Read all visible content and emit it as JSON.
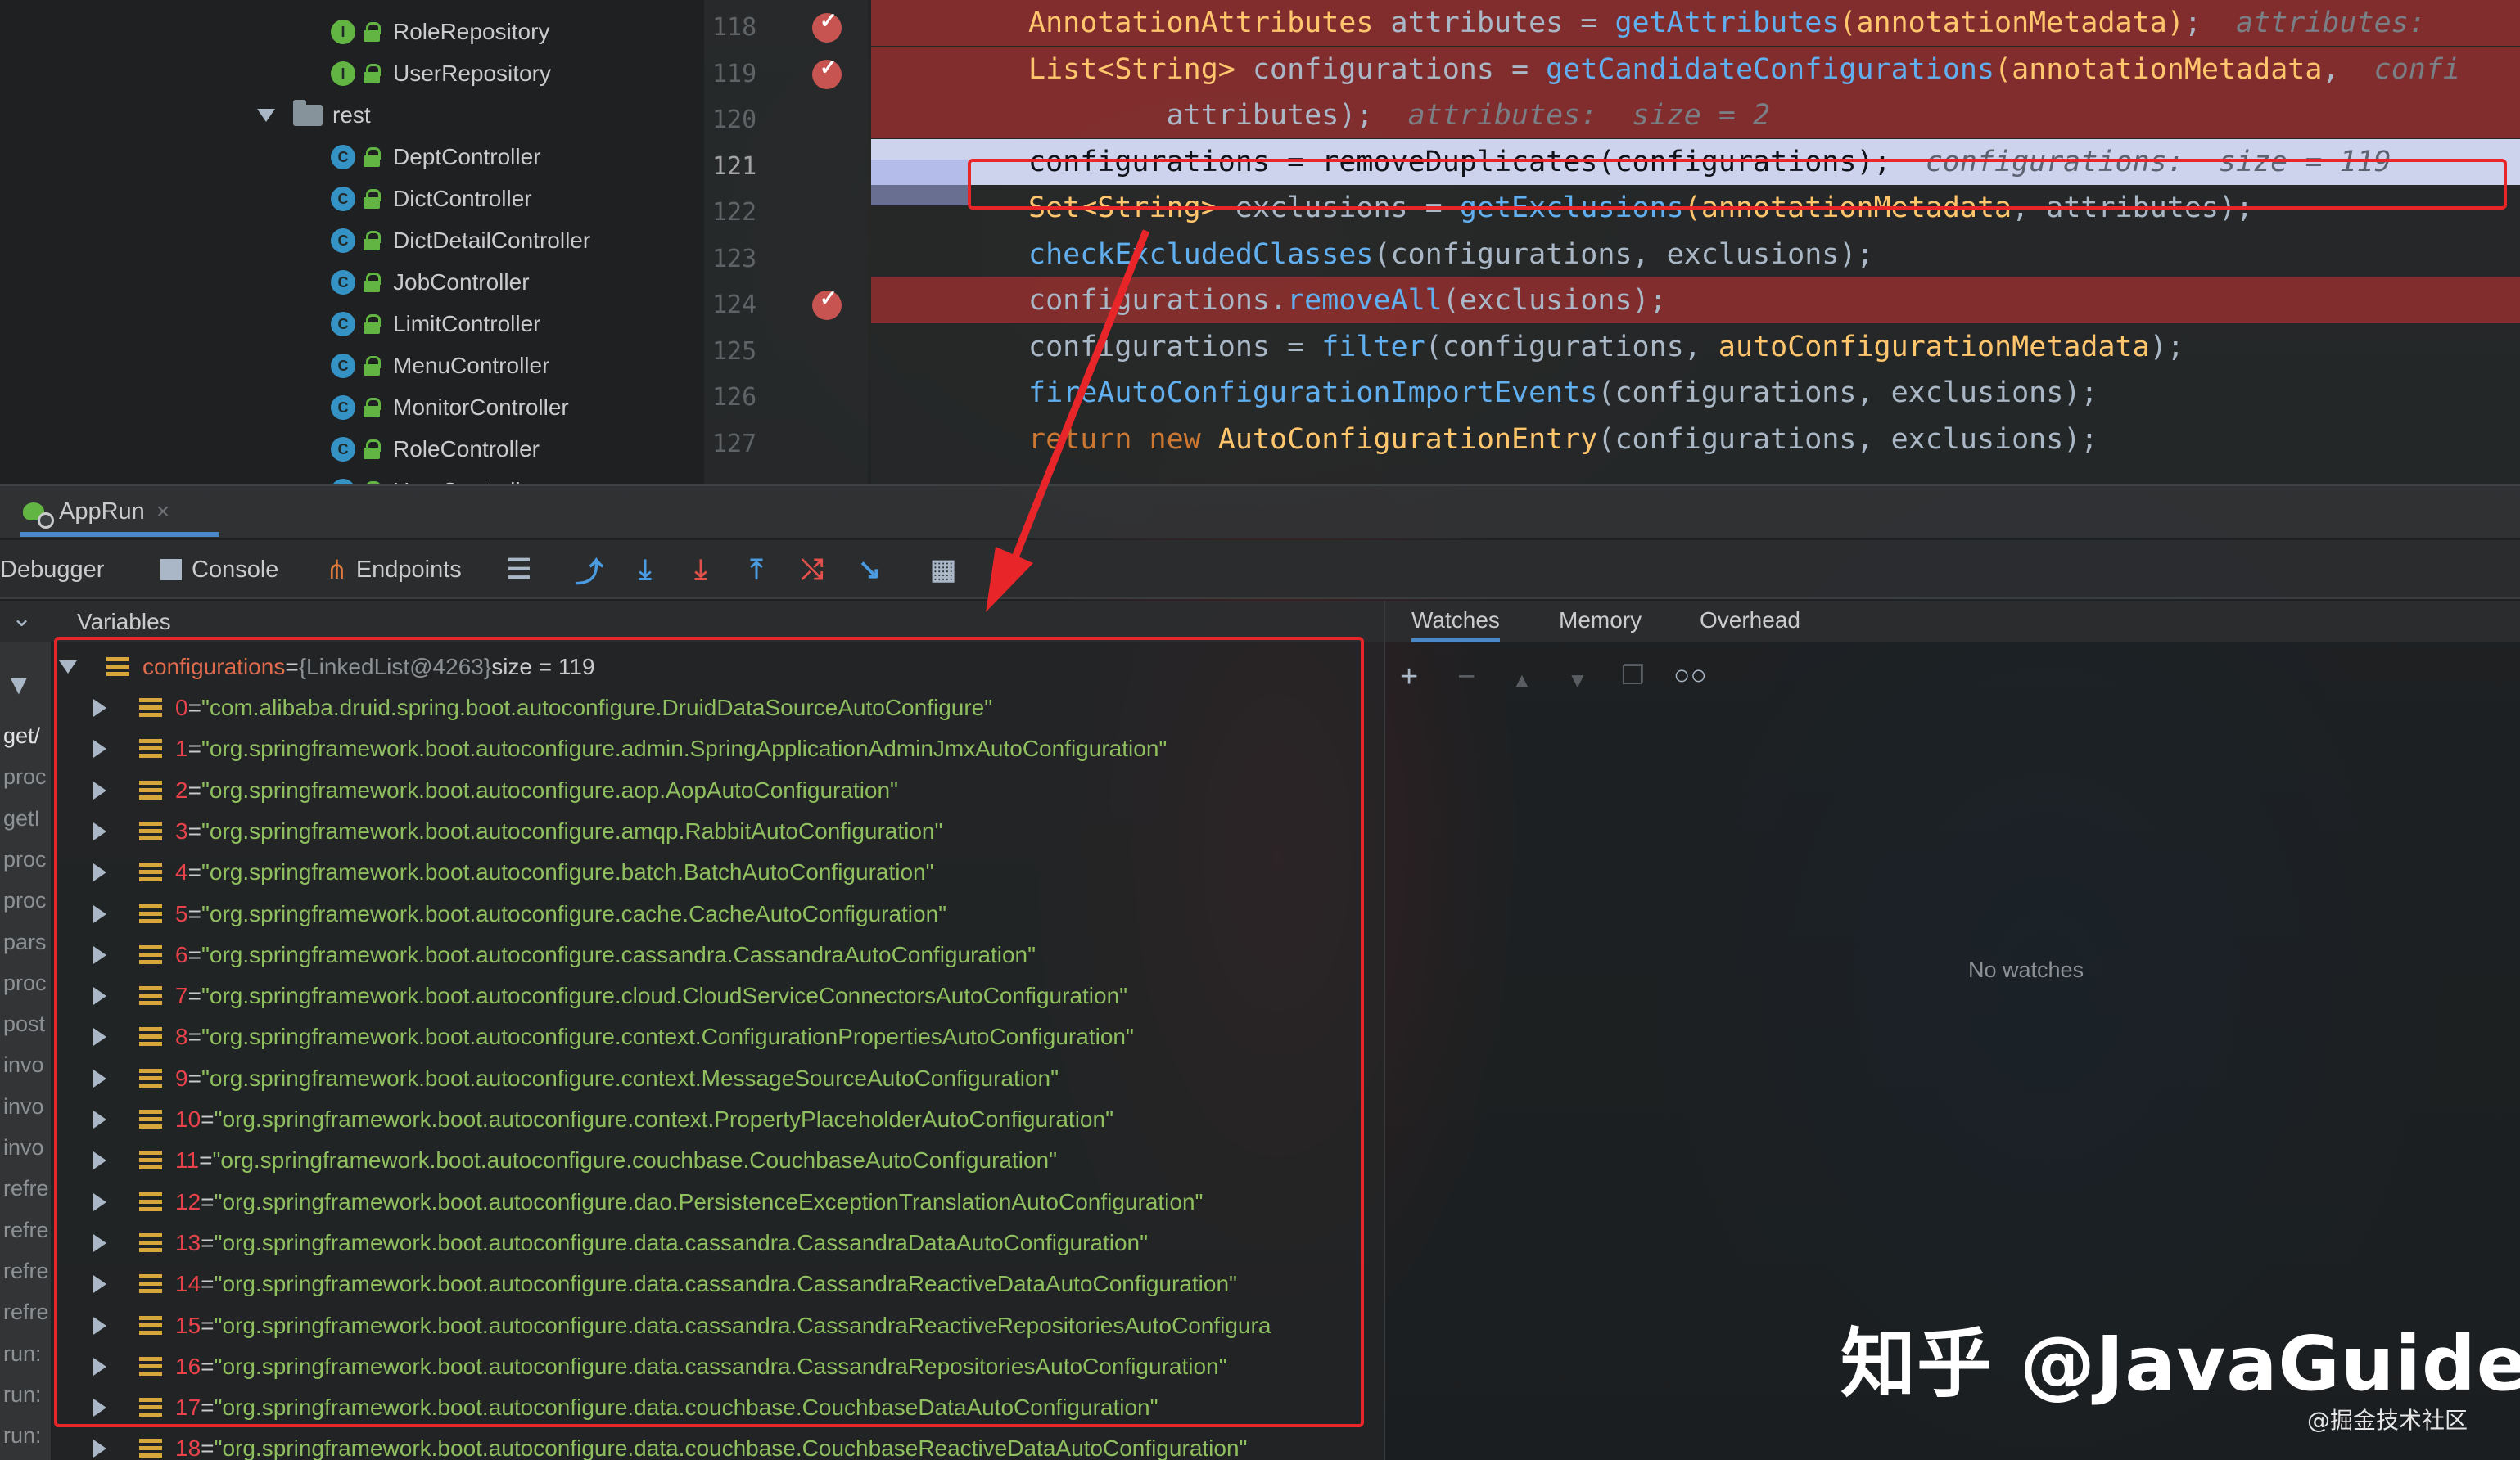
{
  "project_tree": {
    "items": [
      {
        "type": "interface",
        "badge": "I",
        "label": "RoleRepository"
      },
      {
        "type": "interface",
        "badge": "I",
        "label": "UserRepository"
      },
      {
        "type": "folder",
        "label": "rest"
      },
      {
        "type": "class",
        "badge": "C",
        "label": "DeptController"
      },
      {
        "type": "class",
        "badge": "C",
        "label": "DictController"
      },
      {
        "type": "class",
        "badge": "C",
        "label": "DictDetailController"
      },
      {
        "type": "class",
        "badge": "C",
        "label": "JobController"
      },
      {
        "type": "class",
        "badge": "C",
        "label": "LimitController"
      },
      {
        "type": "class",
        "badge": "C",
        "label": "MenuController"
      },
      {
        "type": "class",
        "badge": "C",
        "label": "MonitorController"
      },
      {
        "type": "class",
        "badge": "C",
        "label": "RoleController"
      },
      {
        "type": "class",
        "badge": "C",
        "label": "UserController"
      }
    ]
  },
  "editor": {
    "lines": [
      {
        "num": "118",
        "breakpoint": true,
        "style": "bp"
      },
      {
        "num": "119",
        "breakpoint": true,
        "style": "bp"
      },
      {
        "num": "120",
        "breakpoint": false,
        "style": "bp"
      },
      {
        "num": "121",
        "breakpoint": false,
        "style": "exec"
      },
      {
        "num": "122",
        "breakpoint": false,
        "style": "none"
      },
      {
        "num": "123",
        "breakpoint": false,
        "style": "none"
      },
      {
        "num": "124",
        "breakpoint": true,
        "style": "bp"
      },
      {
        "num": "125",
        "breakpoint": false,
        "style": "none"
      },
      {
        "num": "126",
        "breakpoint": false,
        "style": "none"
      },
      {
        "num": "127",
        "breakpoint": false,
        "style": "none"
      }
    ],
    "code": [
      [
        [
          "t-orange",
          "AnnotationAttributes"
        ],
        [
          "t-plain",
          " attributes = "
        ],
        [
          "t-call",
          "getAttributes"
        ],
        [
          "t-orange",
          "("
        ],
        [
          "t-orange",
          "annotationMetadata"
        ],
        [
          "t-orange",
          ")"
        ],
        [
          "t-plain",
          ";  "
        ],
        [
          "t-hint",
          "attributes: "
        ]
      ],
      [
        [
          "t-orange",
          "List<String>"
        ],
        [
          "t-plain",
          " configurations = "
        ],
        [
          "t-call",
          "getCandidateConfigurations"
        ],
        [
          "t-orange",
          "("
        ],
        [
          "t-orange",
          "annotationMetadata"
        ],
        [
          "t-plain",
          ",  "
        ],
        [
          "t-hint",
          "confi"
        ]
      ],
      [
        [
          "t-plain",
          "        attributes);  "
        ],
        [
          "t-hint",
          "attributes:  size = 2"
        ]
      ],
      [
        [
          "t-plain",
          "configurations = removeDuplicates(configurations);  "
        ],
        [
          "t-hint",
          "configurations:  size = 119"
        ]
      ],
      [
        [
          "t-orange",
          "Set<String>"
        ],
        [
          "t-plain",
          " exclusions = "
        ],
        [
          "t-call",
          "getExclusions"
        ],
        [
          "t-orange",
          "("
        ],
        [
          "t-orange",
          "annotationMetadata"
        ],
        [
          "t-plain",
          ", attributes);"
        ]
      ],
      [
        [
          "t-call",
          "checkExcludedClasses"
        ],
        [
          "t-plain",
          "(configurations, exclusions);"
        ]
      ],
      [
        [
          "t-plain",
          "configurations."
        ],
        [
          "t-call",
          "removeAll"
        ],
        [
          "t-plain",
          "(exclusions);"
        ]
      ],
      [
        [
          "t-plain",
          "configurations = "
        ],
        [
          "t-call",
          "filter"
        ],
        [
          "t-plain",
          "(configurations, "
        ],
        [
          "t-orange",
          "autoConfigurationMetadata"
        ],
        [
          "t-plain",
          ");"
        ]
      ],
      [
        [
          "t-call",
          "fireAutoConfigurationImportEvents"
        ],
        [
          "t-plain",
          "(configurations, exclusions);"
        ]
      ],
      [
        [
          "t-kw",
          "return new "
        ],
        [
          "t-orange",
          "AutoConfigurationEntry"
        ],
        [
          "t-plain",
          "(configurations, exclusions);"
        ]
      ]
    ]
  },
  "run_tab": {
    "label": "AppRun",
    "close": "×"
  },
  "toolbar": {
    "debugger": "Debugger",
    "console": "Console",
    "endpoints": "Endpoints"
  },
  "variables": {
    "header": "Variables",
    "root": {
      "name": "configurations",
      "eq": " = ",
      "meta": "{LinkedList@4263}",
      "size": "  size = 119"
    },
    "items": [
      {
        "idx": "0",
        "value": "\"com.alibaba.druid.spring.boot.autoconfigure.DruidDataSourceAutoConfigure\""
      },
      {
        "idx": "1",
        "value": "\"org.springframework.boot.autoconfigure.admin.SpringApplicationAdminJmxAutoConfiguration\""
      },
      {
        "idx": "2",
        "value": "\"org.springframework.boot.autoconfigure.aop.AopAutoConfiguration\""
      },
      {
        "idx": "3",
        "value": "\"org.springframework.boot.autoconfigure.amqp.RabbitAutoConfiguration\""
      },
      {
        "idx": "4",
        "value": "\"org.springframework.boot.autoconfigure.batch.BatchAutoConfiguration\""
      },
      {
        "idx": "5",
        "value": "\"org.springframework.boot.autoconfigure.cache.CacheAutoConfiguration\""
      },
      {
        "idx": "6",
        "value": "\"org.springframework.boot.autoconfigure.cassandra.CassandraAutoConfiguration\""
      },
      {
        "idx": "7",
        "value": "\"org.springframework.boot.autoconfigure.cloud.CloudServiceConnectorsAutoConfiguration\""
      },
      {
        "idx": "8",
        "value": "\"org.springframework.boot.autoconfigure.context.ConfigurationPropertiesAutoConfiguration\""
      },
      {
        "idx": "9",
        "value": "\"org.springframework.boot.autoconfigure.context.MessageSourceAutoConfiguration\""
      },
      {
        "idx": "10",
        "value": "\"org.springframework.boot.autoconfigure.context.PropertyPlaceholderAutoConfiguration\""
      },
      {
        "idx": "11",
        "value": "\"org.springframework.boot.autoconfigure.couchbase.CouchbaseAutoConfiguration\""
      },
      {
        "idx": "12",
        "value": "\"org.springframework.boot.autoconfigure.dao.PersistenceExceptionTranslationAutoConfiguration\""
      },
      {
        "idx": "13",
        "value": "\"org.springframework.boot.autoconfigure.data.cassandra.CassandraDataAutoConfiguration\""
      },
      {
        "idx": "14",
        "value": "\"org.springframework.boot.autoconfigure.data.cassandra.CassandraReactiveDataAutoConfiguration\""
      },
      {
        "idx": "15",
        "value": "\"org.springframework.boot.autoconfigure.data.cassandra.CassandraReactiveRepositoriesAutoConfigura"
      },
      {
        "idx": "16",
        "value": "\"org.springframework.boot.autoconfigure.data.cassandra.CassandraRepositoriesAutoConfiguration\""
      },
      {
        "idx": "17",
        "value": "\"org.springframework.boot.autoconfigure.data.couchbase.CouchbaseDataAutoConfiguration\""
      },
      {
        "idx": "18",
        "value": "\"org.springframework.boot.autoconfigure.data.couchbase.CouchbaseReactiveDataAutoConfiguration\""
      }
    ]
  },
  "frames": [
    "get/",
    "proc",
    "getI",
    "proc",
    "proc",
    "pars",
    "proc",
    "post",
    "invo",
    "invo",
    "invo",
    "refre",
    "refre",
    "refre",
    "refre",
    "run:",
    "run:",
    "run:"
  ],
  "watches": {
    "tabs": [
      "Watches",
      "Memory",
      "Overhead"
    ],
    "empty": "No watches"
  },
  "watermark": {
    "main": "知乎 @JavaGuide",
    "sub": "@掘金技术社区"
  },
  "colors": {
    "highlight_box": "#e8262a",
    "breakpoint": "#c75450",
    "selection": "#4a88c7"
  }
}
